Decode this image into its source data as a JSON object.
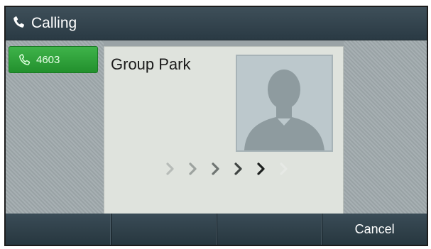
{
  "titlebar": {
    "title": "Calling",
    "icon": "phone-handset-icon"
  },
  "line_key": {
    "label": "4603",
    "icon": "phone-handset-icon",
    "color": "#2fa63b"
  },
  "call": {
    "contact_name": "Group Park",
    "avatar_icon": "person-silhouette-icon",
    "progress_steps_total": 6,
    "progress_steps_active": 5
  },
  "softkeys": [
    {
      "label": ""
    },
    {
      "label": ""
    },
    {
      "label": ""
    },
    {
      "label": "Cancel"
    }
  ]
}
